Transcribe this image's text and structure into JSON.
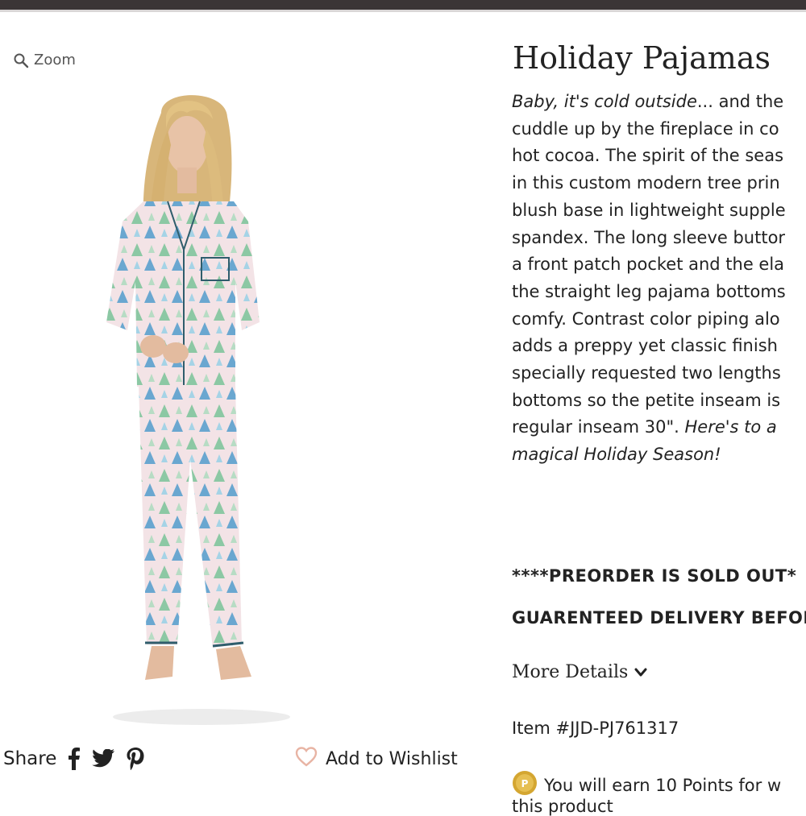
{
  "zoom": {
    "label": "Zoom"
  },
  "product": {
    "title": "Holiday Pajamas",
    "description_lines": [
      {
        "italic": "Baby, it's cold outside",
        "text": "... and the"
      },
      {
        "text": "cuddle up by the fireplace in co"
      },
      {
        "text": "hot cocoa. The spirit of the seas"
      },
      {
        "text": "in this custom modern tree prin"
      },
      {
        "text": "blush base in lightweight supple"
      },
      {
        "text": "spandex. The long sleeve buttor"
      },
      {
        "text": "a front patch pocket and the ela"
      },
      {
        "text": "the straight leg pajama bottoms"
      },
      {
        "text": "comfy. Contrast color piping alo"
      },
      {
        "text": "adds a preppy yet classic finish"
      },
      {
        "text": "specially requested two lengths"
      },
      {
        "text": "bottoms so the petite inseam is"
      },
      {
        "text": "regular inseam 30\". ",
        "italic_after": "Here's to a"
      },
      {
        "italic": "magical Holiday Season!"
      }
    ],
    "notice_1": "****PREORDER IS SOLD OUT*",
    "notice_2": "GUARENTEED DELIVERY BEFOR",
    "more_details": "More Details",
    "item_number": "Item #JJD-PJ761317",
    "points_text": "You will earn 10 Points for w",
    "points_text_2": "this product"
  },
  "share": {
    "label": "Share",
    "icons": [
      "facebook-icon",
      "twitter-icon",
      "pinterest-icon"
    ]
  },
  "wishlist": {
    "label": "Add to Wishlist"
  },
  "colors": {
    "topbar": "#3b3536",
    "pajama_base": "#f3e3e6",
    "tree_green": "#8cc8a4",
    "tree_blue": "#6aa7d0",
    "piping": "#2f5d6c",
    "points_coin": "#d4a631"
  }
}
